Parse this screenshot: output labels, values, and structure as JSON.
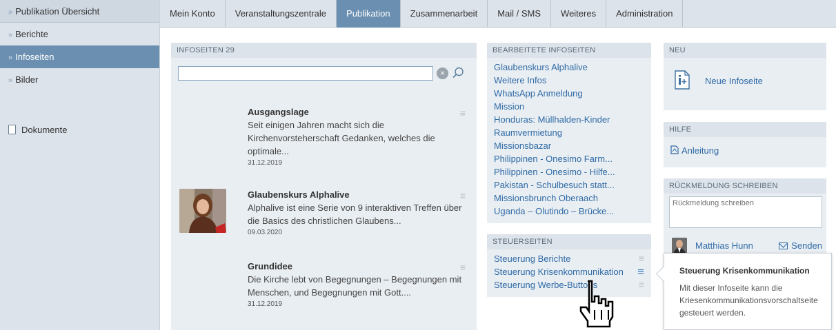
{
  "sidebar": {
    "items": [
      {
        "label": "Publikation Übersicht"
      },
      {
        "label": "Berichte"
      },
      {
        "label": "Infoseiten"
      },
      {
        "label": "Bilder"
      }
    ],
    "documents_label": "Dokumente"
  },
  "topnav": {
    "tabs": [
      {
        "label": "Mein Konto"
      },
      {
        "label": "Veranstaltungszentrale"
      },
      {
        "label": "Publikation"
      },
      {
        "label": "Zusammenarbeit"
      },
      {
        "label": "Mail / SMS"
      },
      {
        "label": "Weiteres"
      },
      {
        "label": "Administration"
      }
    ],
    "active_tab": "Publikation"
  },
  "infoseiten": {
    "heading": "INFOSEITEN",
    "count": "29",
    "search": {
      "value": "",
      "placeholder": ""
    },
    "articles": [
      {
        "title": "Ausgangslage",
        "description": "Seit einigen Jahren macht sich die Kirchenvorsteherschaft Gedanken, welches die optimale...",
        "date": "31.12.2019"
      },
      {
        "title": "Glaubenskurs Alphalive",
        "description": "Alphalive ist eine Serie von 9 interaktiven Treffen über die Basics des christlichen Glaubens...",
        "date": "09.03.2020"
      },
      {
        "title": "Grundidee",
        "description": "Die Kirche lebt von Begegnungen – Begegnungen mit Menschen, und Begegnungen mit Gott....",
        "date": "31.12.2019"
      }
    ]
  },
  "bearbeitete": {
    "heading": "BEARBEITETE INFOSEITEN",
    "links": [
      "Glaubenskurs Alphalive",
      "Weitere Infos",
      "WhatsApp Anmeldung",
      "Mission",
      "Honduras: Müllhalden-Kinder",
      "Raumvermietung",
      "Missionsbazar",
      "Philippinen - Onesimo Farm...",
      "Philippinen - Onesimo - Hilfe...",
      "Pakistan - Schulbesuch statt...",
      "Missionsbrunch Oberaach",
      "Uganda – Olutindo – Brücke..."
    ]
  },
  "steuerseiten": {
    "heading": "STEUERSEITEN",
    "items": [
      "Steuerung Berichte",
      "Steuerung Krisenkommunikation",
      "Steuerung Werbe-Buttons"
    ]
  },
  "neu": {
    "heading": "NEU",
    "label": "Neue Infoseite"
  },
  "hilfe": {
    "heading": "HILFE",
    "label": "Anleitung"
  },
  "rueckmeldung": {
    "heading": "RÜCKMELDUNG SCHREIBEN",
    "placeholder": "Rückmeldung schreiben",
    "user": "Matthias Hunn",
    "send_label": "Senden"
  },
  "tooltip": {
    "title": "Steuerung Krisenkommunikation",
    "text": "Mit dieser Infoseite kann die Kriesenkommunikationsvorschaltseite gesteuert werden."
  },
  "colors": {
    "accent": "#6a8fb0",
    "link": "#2f6aa6",
    "panel": "#e9eef2"
  }
}
